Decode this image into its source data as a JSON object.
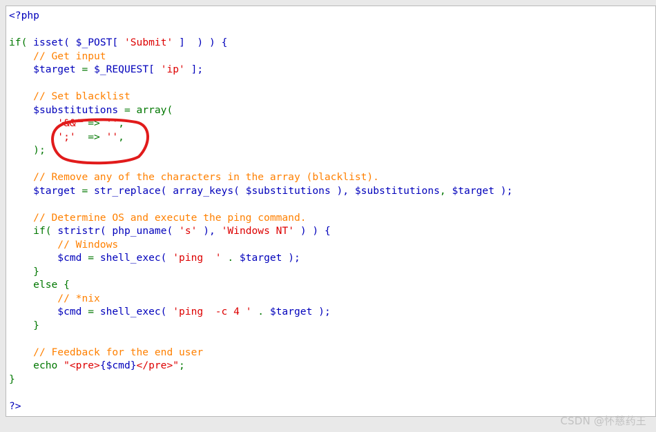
{
  "code": {
    "lines": [
      [
        {
          "t": "<?php",
          "c": "var"
        }
      ],
      [],
      [
        {
          "t": "if(",
          "c": "kw"
        },
        {
          "t": " ",
          "c": "txt"
        },
        {
          "t": "isset(",
          "c": "var"
        },
        {
          "t": " ",
          "c": "txt"
        },
        {
          "t": "$_POST[",
          "c": "var"
        },
        {
          "t": " ",
          "c": "txt"
        },
        {
          "t": "'Submit'",
          "c": "str"
        },
        {
          "t": " ]  ) ) {",
          "c": "var"
        }
      ],
      [
        {
          "t": "    ",
          "c": "txt"
        },
        {
          "t": "// Get input",
          "c": "com"
        }
      ],
      [
        {
          "t": "    ",
          "c": "txt"
        },
        {
          "t": "$target",
          "c": "var"
        },
        {
          "t": " = ",
          "c": "op"
        },
        {
          "t": "$_REQUEST[",
          "c": "var"
        },
        {
          "t": " ",
          "c": "txt"
        },
        {
          "t": "'ip'",
          "c": "str"
        },
        {
          "t": " ];",
          "c": "var"
        }
      ],
      [],
      [
        {
          "t": "    ",
          "c": "txt"
        },
        {
          "t": "// Set blacklist",
          "c": "com"
        }
      ],
      [
        {
          "t": "    ",
          "c": "txt"
        },
        {
          "t": "$substitutions",
          "c": "var"
        },
        {
          "t": " = ",
          "c": "op"
        },
        {
          "t": "array(",
          "c": "kw"
        }
      ],
      [
        {
          "t": "        ",
          "c": "txt"
        },
        {
          "t": "'&&'",
          "c": "str"
        },
        {
          "t": " => ",
          "c": "op"
        },
        {
          "t": "''",
          "c": "str"
        },
        {
          "t": ",",
          "c": "op"
        }
      ],
      [
        {
          "t": "        ",
          "c": "txt"
        },
        {
          "t": "';'",
          "c": "str"
        },
        {
          "t": "  => ",
          "c": "op"
        },
        {
          "t": "''",
          "c": "str"
        },
        {
          "t": ",",
          "c": "op"
        }
      ],
      [
        {
          "t": "    ",
          "c": "txt"
        },
        {
          "t": ");",
          "c": "kw"
        }
      ],
      [],
      [
        {
          "t": "    ",
          "c": "txt"
        },
        {
          "t": "// Remove any of the characters in the array (blacklist).",
          "c": "com"
        }
      ],
      [
        {
          "t": "    ",
          "c": "txt"
        },
        {
          "t": "$target",
          "c": "var"
        },
        {
          "t": " = ",
          "c": "op"
        },
        {
          "t": "str_replace(",
          "c": "var"
        },
        {
          "t": " ",
          "c": "txt"
        },
        {
          "t": "array_keys(",
          "c": "var"
        },
        {
          "t": " ",
          "c": "txt"
        },
        {
          "t": "$substitutions",
          "c": "var"
        },
        {
          "t": " ), ",
          "c": "var"
        },
        {
          "t": "$substitutions",
          "c": "var"
        },
        {
          "t": ", ",
          "c": "op"
        },
        {
          "t": "$target",
          "c": "var"
        },
        {
          "t": " );",
          "c": "var"
        }
      ],
      [],
      [
        {
          "t": "    ",
          "c": "txt"
        },
        {
          "t": "// Determine OS and execute the ping command.",
          "c": "com"
        }
      ],
      [
        {
          "t": "    ",
          "c": "txt"
        },
        {
          "t": "if(",
          "c": "kw"
        },
        {
          "t": " ",
          "c": "txt"
        },
        {
          "t": "stristr(",
          "c": "var"
        },
        {
          "t": " ",
          "c": "txt"
        },
        {
          "t": "php_uname(",
          "c": "var"
        },
        {
          "t": " ",
          "c": "txt"
        },
        {
          "t": "'s'",
          "c": "str"
        },
        {
          "t": " ), ",
          "c": "var"
        },
        {
          "t": "'Windows NT'",
          "c": "str"
        },
        {
          "t": " ) ) {",
          "c": "var"
        }
      ],
      [
        {
          "t": "        ",
          "c": "txt"
        },
        {
          "t": "// Windows",
          "c": "com"
        }
      ],
      [
        {
          "t": "        ",
          "c": "txt"
        },
        {
          "t": "$cmd",
          "c": "var"
        },
        {
          "t": " = ",
          "c": "op"
        },
        {
          "t": "shell_exec(",
          "c": "var"
        },
        {
          "t": " ",
          "c": "txt"
        },
        {
          "t": "'ping  '",
          "c": "str"
        },
        {
          "t": " . ",
          "c": "op"
        },
        {
          "t": "$target",
          "c": "var"
        },
        {
          "t": " );",
          "c": "var"
        }
      ],
      [
        {
          "t": "    ",
          "c": "txt"
        },
        {
          "t": "}",
          "c": "kw"
        }
      ],
      [
        {
          "t": "    ",
          "c": "txt"
        },
        {
          "t": "else {",
          "c": "kw"
        }
      ],
      [
        {
          "t": "        ",
          "c": "txt"
        },
        {
          "t": "// *nix",
          "c": "com"
        }
      ],
      [
        {
          "t": "        ",
          "c": "txt"
        },
        {
          "t": "$cmd",
          "c": "var"
        },
        {
          "t": " = ",
          "c": "op"
        },
        {
          "t": "shell_exec(",
          "c": "var"
        },
        {
          "t": " ",
          "c": "txt"
        },
        {
          "t": "'ping  -c 4 '",
          "c": "str"
        },
        {
          "t": " . ",
          "c": "op"
        },
        {
          "t": "$target",
          "c": "var"
        },
        {
          "t": " );",
          "c": "var"
        }
      ],
      [
        {
          "t": "    ",
          "c": "txt"
        },
        {
          "t": "}",
          "c": "kw"
        }
      ],
      [],
      [
        {
          "t": "    ",
          "c": "txt"
        },
        {
          "t": "// Feedback for the end user",
          "c": "com"
        }
      ],
      [
        {
          "t": "    ",
          "c": "txt"
        },
        {
          "t": "echo ",
          "c": "kw"
        },
        {
          "t": "\"<pre>",
          "c": "str"
        },
        {
          "t": "{$cmd}",
          "c": "var"
        },
        {
          "t": "</pre>\"",
          "c": "str"
        },
        {
          "t": ";",
          "c": "op"
        }
      ],
      [
        {
          "t": "}",
          "c": "kw"
        }
      ],
      [],
      [
        {
          "t": "?>",
          "c": "var"
        }
      ]
    ]
  },
  "annotation": {
    "shape": "hand-drawn-circle",
    "color": "#e11b1b"
  },
  "watermark": "CSDN @怀慈药王"
}
